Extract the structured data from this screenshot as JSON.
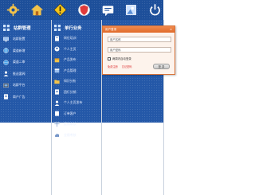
{
  "toolbar": {
    "buttons": [
      {
        "icon": "gear-icon",
        "color": "#f2c24a"
      },
      {
        "icon": "home-icon",
        "color": "#f2c24a"
      },
      {
        "icon": "warning-icon",
        "color": "#f5c518"
      },
      {
        "icon": "shield-icon",
        "color": "#e03a3a"
      },
      {
        "icon": "message-icon",
        "color": "#ffffff"
      },
      {
        "icon": "image-icon",
        "color": "#cfe3ff"
      },
      {
        "icon": "power-icon",
        "color": "#ffffff"
      }
    ]
  },
  "menu": {
    "col1": {
      "heading": "站群管理",
      "items": [
        "站群配置",
        "渠道新增",
        "渠道二审",
        "推送要闻",
        "站群平台",
        "商户广告"
      ]
    },
    "col2": {
      "heading": "单行业务",
      "items": [
        "岗位培训",
        "个人主页",
        "产品发布",
        "产品管理",
        "知识分析",
        "团行分销",
        "个人主页发布",
        "订单客户",
        "报销审核",
        "业绩考核"
      ]
    }
  },
  "login_dialog": {
    "title": "用户登录",
    "close": "×",
    "username_placeholder": "用户名称",
    "password_placeholder": "用户密码",
    "remember_label": "两周内自动登录",
    "link_register": "免费注册",
    "link_forgot": "忘记密码",
    "login_button": "登 录"
  }
}
